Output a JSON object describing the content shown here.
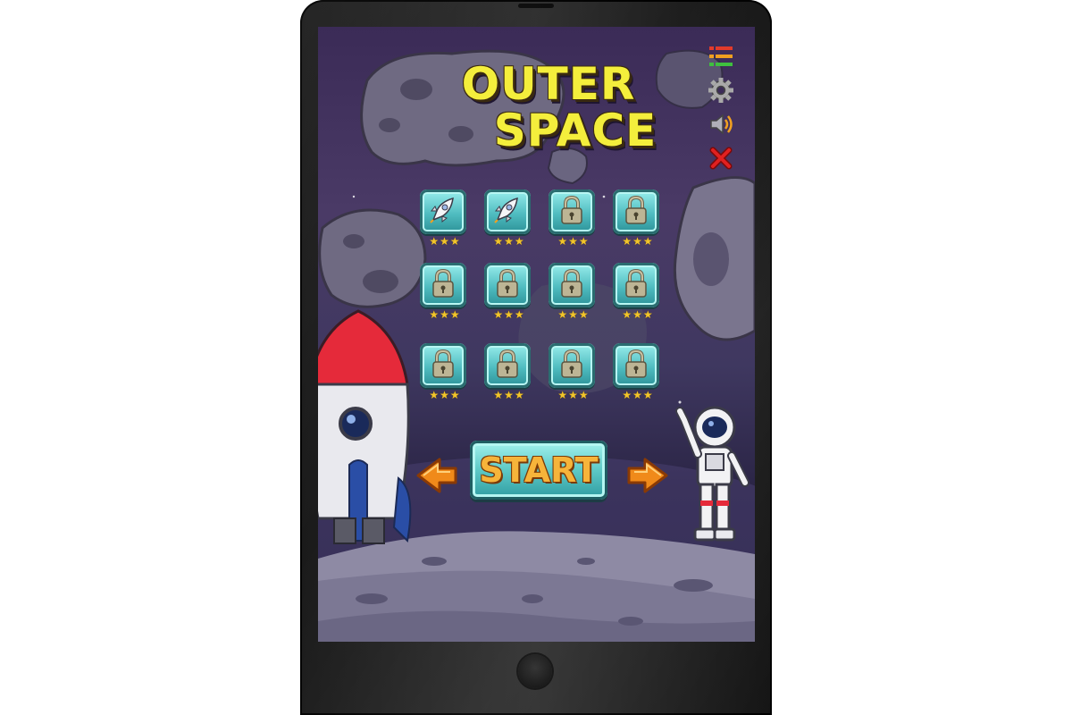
{
  "game": {
    "title_line1": "OUTER",
    "title_line2": "SPACE",
    "start_label": "START"
  },
  "menu": [
    {
      "name": "list-menu-icon",
      "color": "#e23b2b"
    },
    {
      "name": "gear-icon",
      "color": "#9a9a9a"
    },
    {
      "name": "sound-icon",
      "color": "#f0a020"
    },
    {
      "name": "close-icon",
      "color": "#e02020"
    }
  ],
  "levels": [
    {
      "icon": "rocket-icon",
      "locked": false,
      "stars": "★★★"
    },
    {
      "icon": "rocket-icon",
      "locked": false,
      "stars": "★★★"
    },
    {
      "icon": "lock-icon",
      "locked": true,
      "stars": "★★★"
    },
    {
      "icon": "lock-icon",
      "locked": true,
      "stars": "★★★"
    },
    {
      "icon": "lock-icon",
      "locked": true,
      "stars": "★★★"
    },
    {
      "icon": "lock-icon",
      "locked": true,
      "stars": "★★★"
    },
    {
      "icon": "lock-icon",
      "locked": true,
      "stars": "★★★"
    },
    {
      "icon": "lock-icon",
      "locked": true,
      "stars": "★★★"
    },
    {
      "icon": "lock-icon",
      "locked": true,
      "stars": "★★★"
    },
    {
      "icon": "lock-icon",
      "locked": true,
      "stars": "★★★"
    },
    {
      "icon": "lock-icon",
      "locked": true,
      "stars": "★★★"
    },
    {
      "icon": "lock-icon",
      "locked": true,
      "stars": "★★★"
    }
  ],
  "colors": {
    "title": "#f4ee3c",
    "star": "#f2c52a",
    "tile": "#4fbcc0",
    "start_text": "#f6b43a",
    "arrow": "#f08a1a"
  }
}
